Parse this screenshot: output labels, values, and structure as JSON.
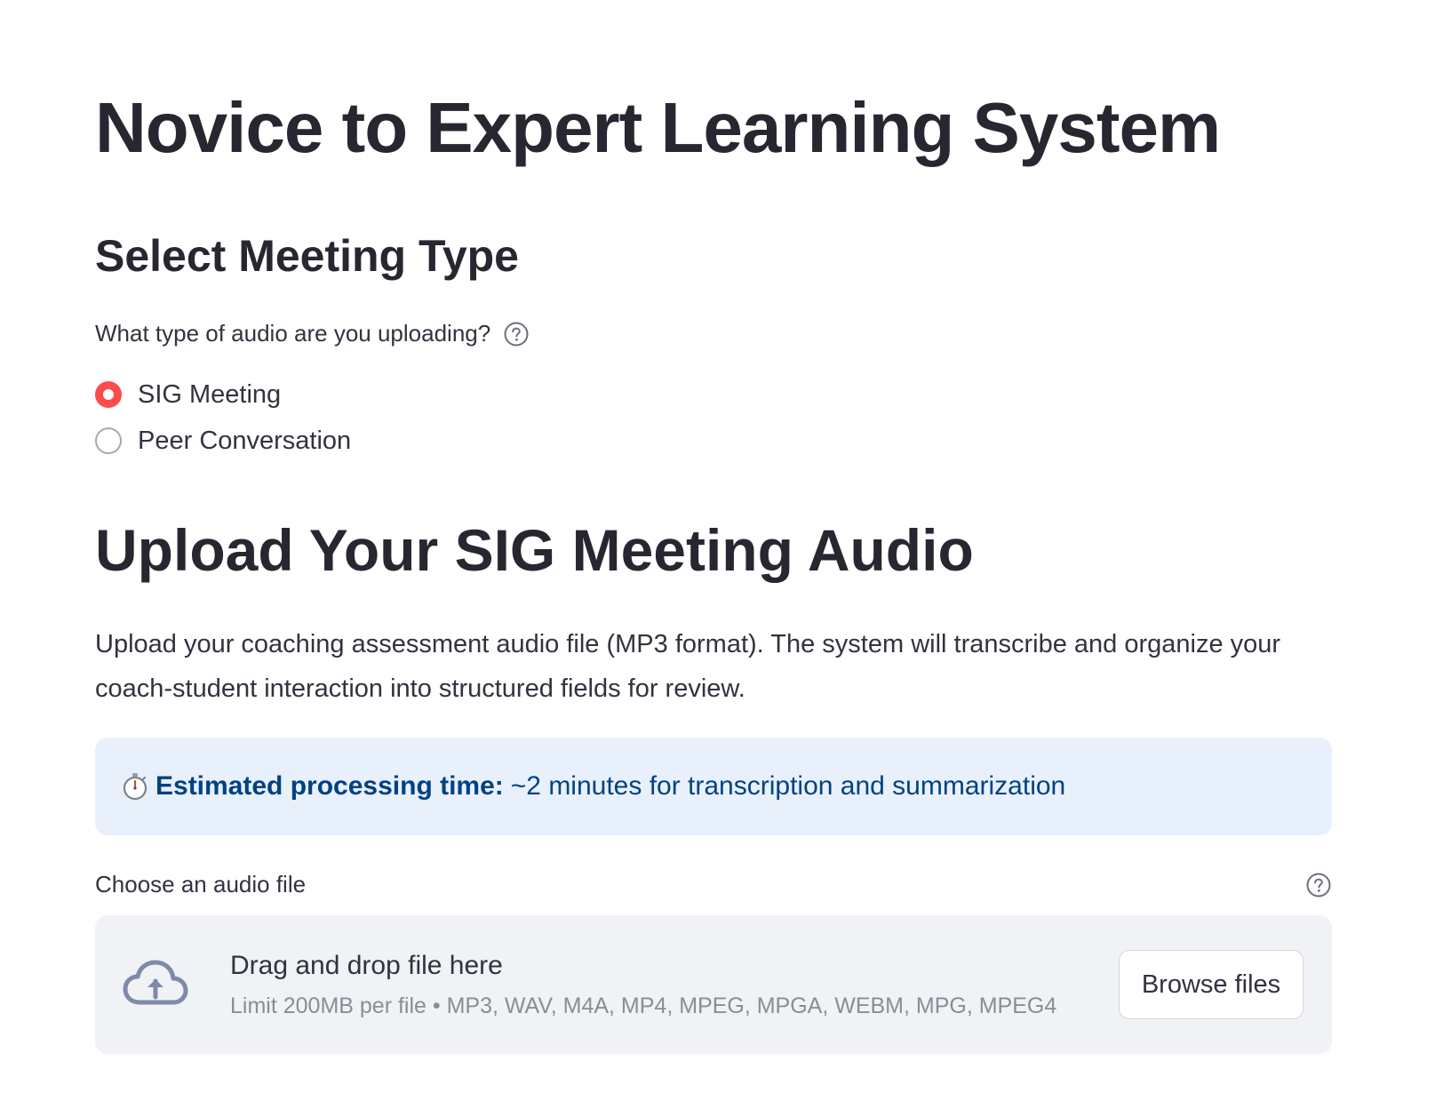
{
  "header": {
    "title": "Novice to Expert Learning System"
  },
  "meeting_type": {
    "section_title": "Select Meeting Type",
    "question": "What type of audio are you uploading?",
    "options": [
      {
        "label": "SIG Meeting",
        "selected": true
      },
      {
        "label": "Peer Conversation",
        "selected": false
      }
    ]
  },
  "upload": {
    "section_title": "Upload Your SIG Meeting Audio",
    "description": "Upload your coaching assessment audio file (MP3 format). The system will transcribe and organize your coach-student interaction into structured fields for review.",
    "info": {
      "icon": "stopwatch-icon",
      "bold_label": "Estimated processing time:",
      "text": "~2 minutes for transcription and summarization"
    },
    "file_label": "Choose an audio file",
    "dropzone": {
      "primary": "Drag and drop file here",
      "secondary": "Limit 200MB per file • MP3, WAV, M4A, MP4, MPEG, MPGA, WEBM, MPG, MPEG4",
      "button_label": "Browse files"
    }
  },
  "colors": {
    "accent": "#ff4b4b",
    "info_bg": "#e8f0fb",
    "info_text": "#004280",
    "dropzone_bg": "#f0f2f6"
  }
}
